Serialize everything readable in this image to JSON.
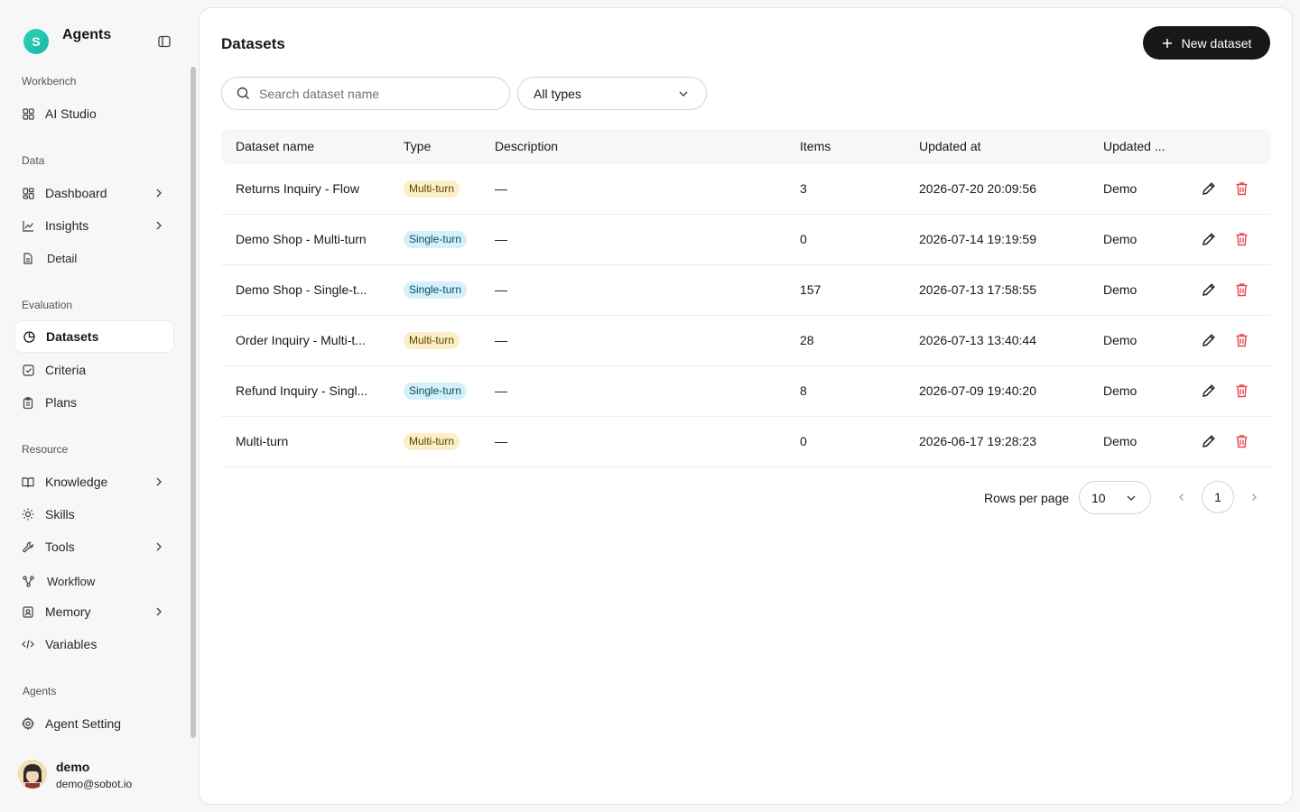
{
  "brand": {
    "logo_letter": "S",
    "name": "Agents"
  },
  "sidebar": {
    "sections": {
      "workbench": "Workbench",
      "data": "Data",
      "evaluation": "Evaluation",
      "resource": "Resource",
      "agents": "Agents"
    },
    "items": [
      {
        "label": "AI Studio",
        "icon": "grid-icon"
      },
      {
        "label": "Dashboard",
        "icon": "dashboard-icon"
      },
      {
        "label": "Insights",
        "icon": "chart-line-icon"
      },
      {
        "label": "Detail",
        "icon": "document-icon"
      },
      {
        "label": "Datasets",
        "icon": "pie-chart-icon"
      },
      {
        "label": "Criteria",
        "icon": "checkbox-icon"
      },
      {
        "label": "Plans",
        "icon": "clipboard-icon"
      },
      {
        "label": "Knowledge",
        "icon": "book-icon"
      },
      {
        "label": "Skills",
        "icon": "sun-icon"
      },
      {
        "label": "Tools",
        "icon": "wrench-icon"
      },
      {
        "label": "Workflow",
        "icon": "workflow-icon"
      },
      {
        "label": "Memory",
        "icon": "memory-icon"
      },
      {
        "label": "Variables",
        "icon": "code-icon"
      },
      {
        "label": "Agent Setting",
        "icon": "gear-icon"
      }
    ]
  },
  "user": {
    "name": "demo",
    "email": "demo@sobot.io"
  },
  "page": {
    "title": "Datasets",
    "new_button": "New dataset",
    "search_placeholder": "Search dataset name",
    "type_filter": "All types"
  },
  "table": {
    "headers": {
      "name": "Dataset name",
      "type": "Type",
      "description": "Description",
      "items": "Items",
      "updated_at": "Updated at",
      "updated_by": "Updated ..."
    },
    "rows": [
      {
        "name": "Returns Inquiry - Flow",
        "type": "Multi-turn",
        "description": "—",
        "items": "3",
        "updated_at": "2026-07-20 20:09:56",
        "updated_by": "Demo"
      },
      {
        "name": "Demo Shop - Multi-turn",
        "type": "Single-turn",
        "description": "—",
        "items": "0",
        "updated_at": "2026-07-14 19:19:59",
        "updated_by": "Demo"
      },
      {
        "name": "Demo Shop - Single-t...",
        "type": "Single-turn",
        "description": "—",
        "items": "157",
        "updated_at": "2026-07-13 17:58:55",
        "updated_by": "Demo"
      },
      {
        "name": "Order Inquiry - Multi-t...",
        "type": "Multi-turn",
        "description": "—",
        "items": "28",
        "updated_at": "2026-07-13 13:40:44",
        "updated_by": "Demo"
      },
      {
        "name": "Refund Inquiry - Singl...",
        "type": "Single-turn",
        "description": "—",
        "items": "8",
        "updated_at": "2026-07-09 19:40:20",
        "updated_by": "Demo"
      },
      {
        "name": "Multi-turn",
        "type": "Multi-turn",
        "description": "—",
        "items": "0",
        "updated_at": "2026-06-17 19:28:23",
        "updated_by": "Demo"
      }
    ]
  },
  "pagination": {
    "rows_label": "Rows per page",
    "rows_value": "10",
    "current_page": "1"
  },
  "colors": {
    "multi_badge_bg": "#fcefc7",
    "single_badge_bg": "#d4f1fb",
    "delete_red": "#e5484d",
    "primary_dark": "#18181b"
  }
}
